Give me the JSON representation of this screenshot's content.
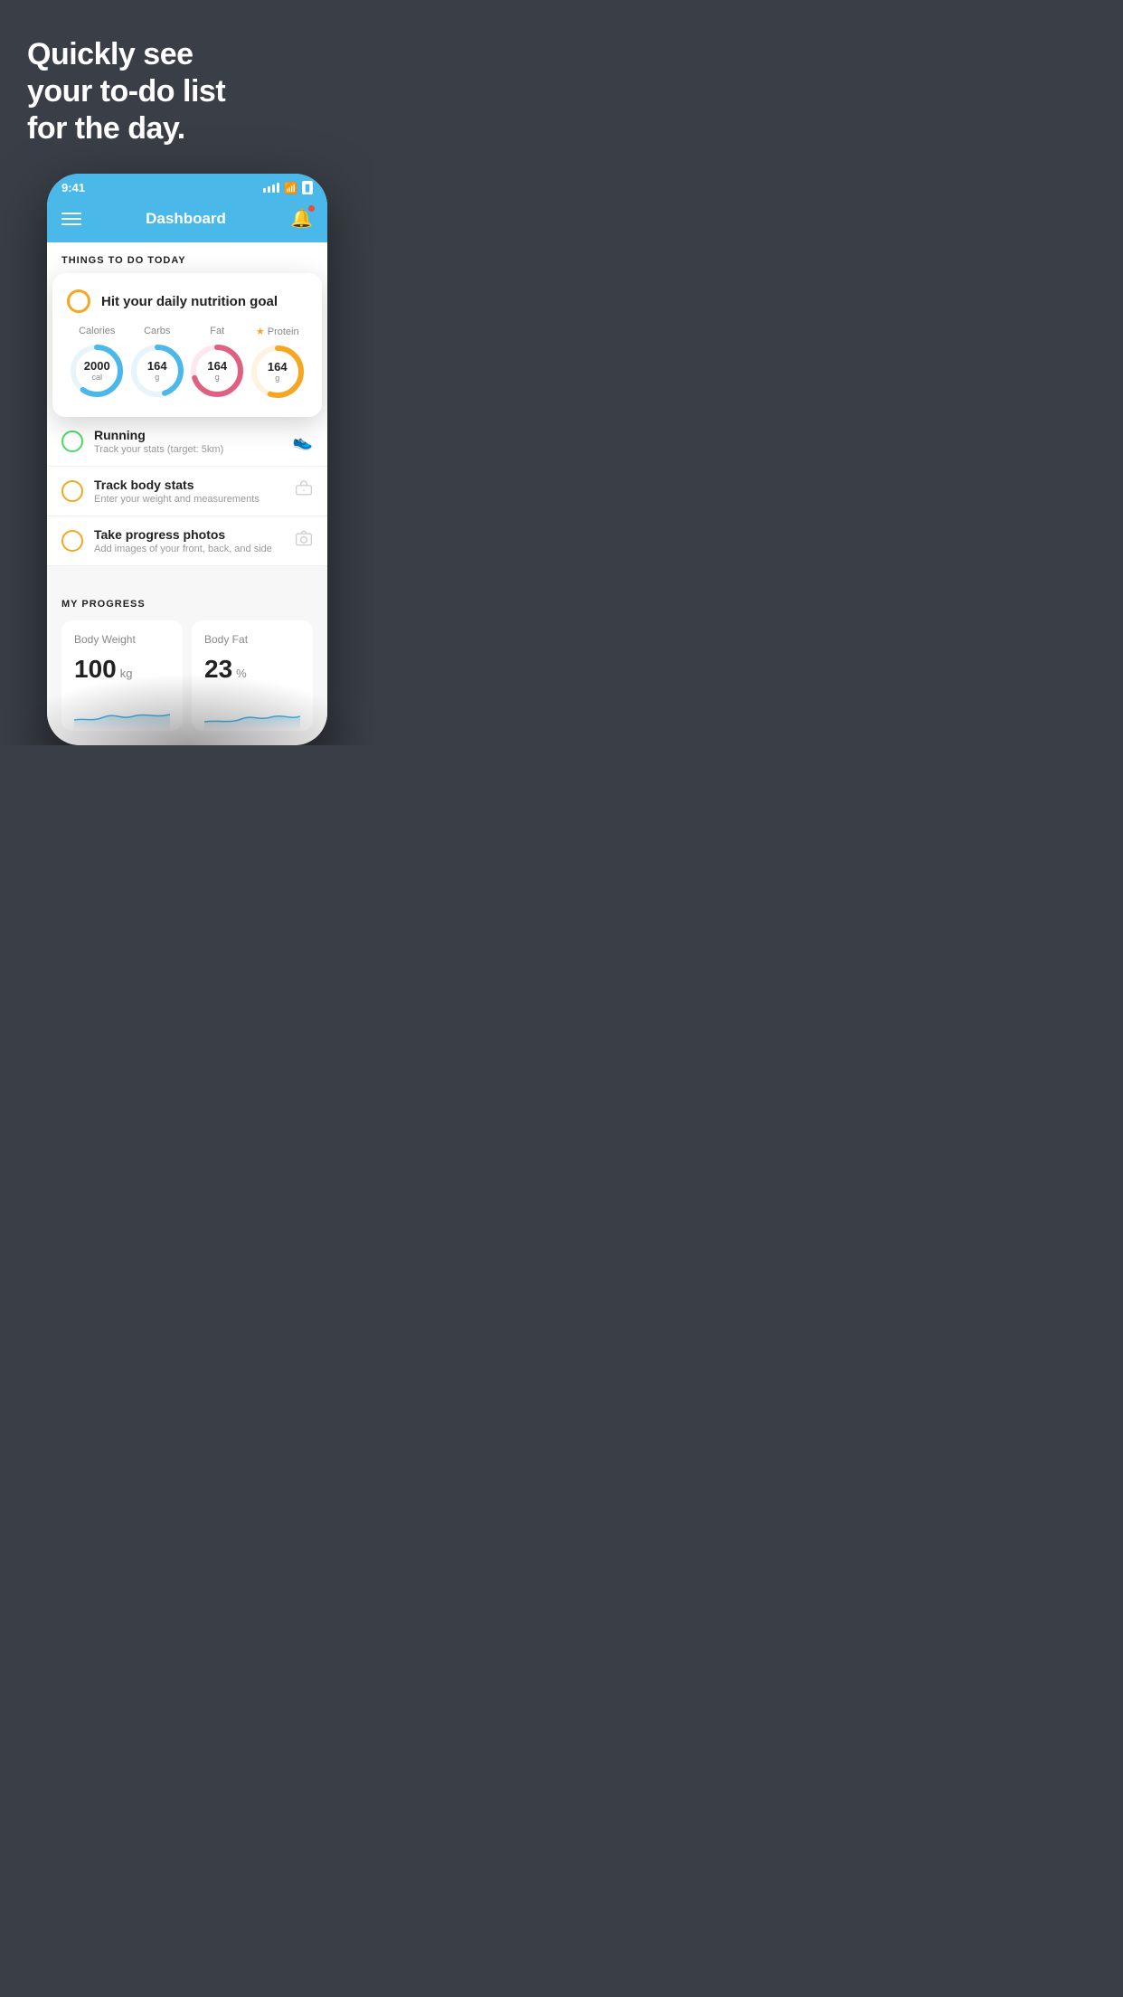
{
  "page": {
    "background": "#3a3f47"
  },
  "hero": {
    "line1": "Quickly see",
    "line2": "your to-do list",
    "line3": "for the day."
  },
  "statusBar": {
    "time": "9:41"
  },
  "navbar": {
    "title": "Dashboard"
  },
  "thingsToDoHeader": "THINGS TO DO TODAY",
  "nutritionCard": {
    "title": "Hit your daily nutrition goal",
    "items": [
      {
        "label": "Calories",
        "value": "2000",
        "unit": "cal",
        "color": "#4ab8e8",
        "star": false,
        "percent": 60
      },
      {
        "label": "Carbs",
        "value": "164",
        "unit": "g",
        "color": "#4ab8e8",
        "star": false,
        "percent": 45
      },
      {
        "label": "Fat",
        "value": "164",
        "unit": "g",
        "color": "#e06080",
        "star": false,
        "percent": 70
      },
      {
        "label": "Protein",
        "value": "164",
        "unit": "g",
        "color": "#f5a623",
        "star": true,
        "percent": 55
      }
    ]
  },
  "todoItems": [
    {
      "id": "running",
      "title": "Running",
      "subtitle": "Track your stats (target: 5km)",
      "circleType": "green",
      "iconUnicode": "👟"
    },
    {
      "id": "track-body",
      "title": "Track body stats",
      "subtitle": "Enter your weight and measurements",
      "circleType": "yellow",
      "iconUnicode": "⚖️"
    },
    {
      "id": "progress-photos",
      "title": "Take progress photos",
      "subtitle": "Add images of your front, back, and side",
      "circleType": "yellow",
      "iconUnicode": "🖼️"
    }
  ],
  "progressSection": {
    "header": "MY PROGRESS",
    "cards": [
      {
        "id": "body-weight",
        "title": "Body Weight",
        "value": "100",
        "unit": "kg"
      },
      {
        "id": "body-fat",
        "title": "Body Fat",
        "value": "23",
        "unit": "%"
      }
    ]
  }
}
